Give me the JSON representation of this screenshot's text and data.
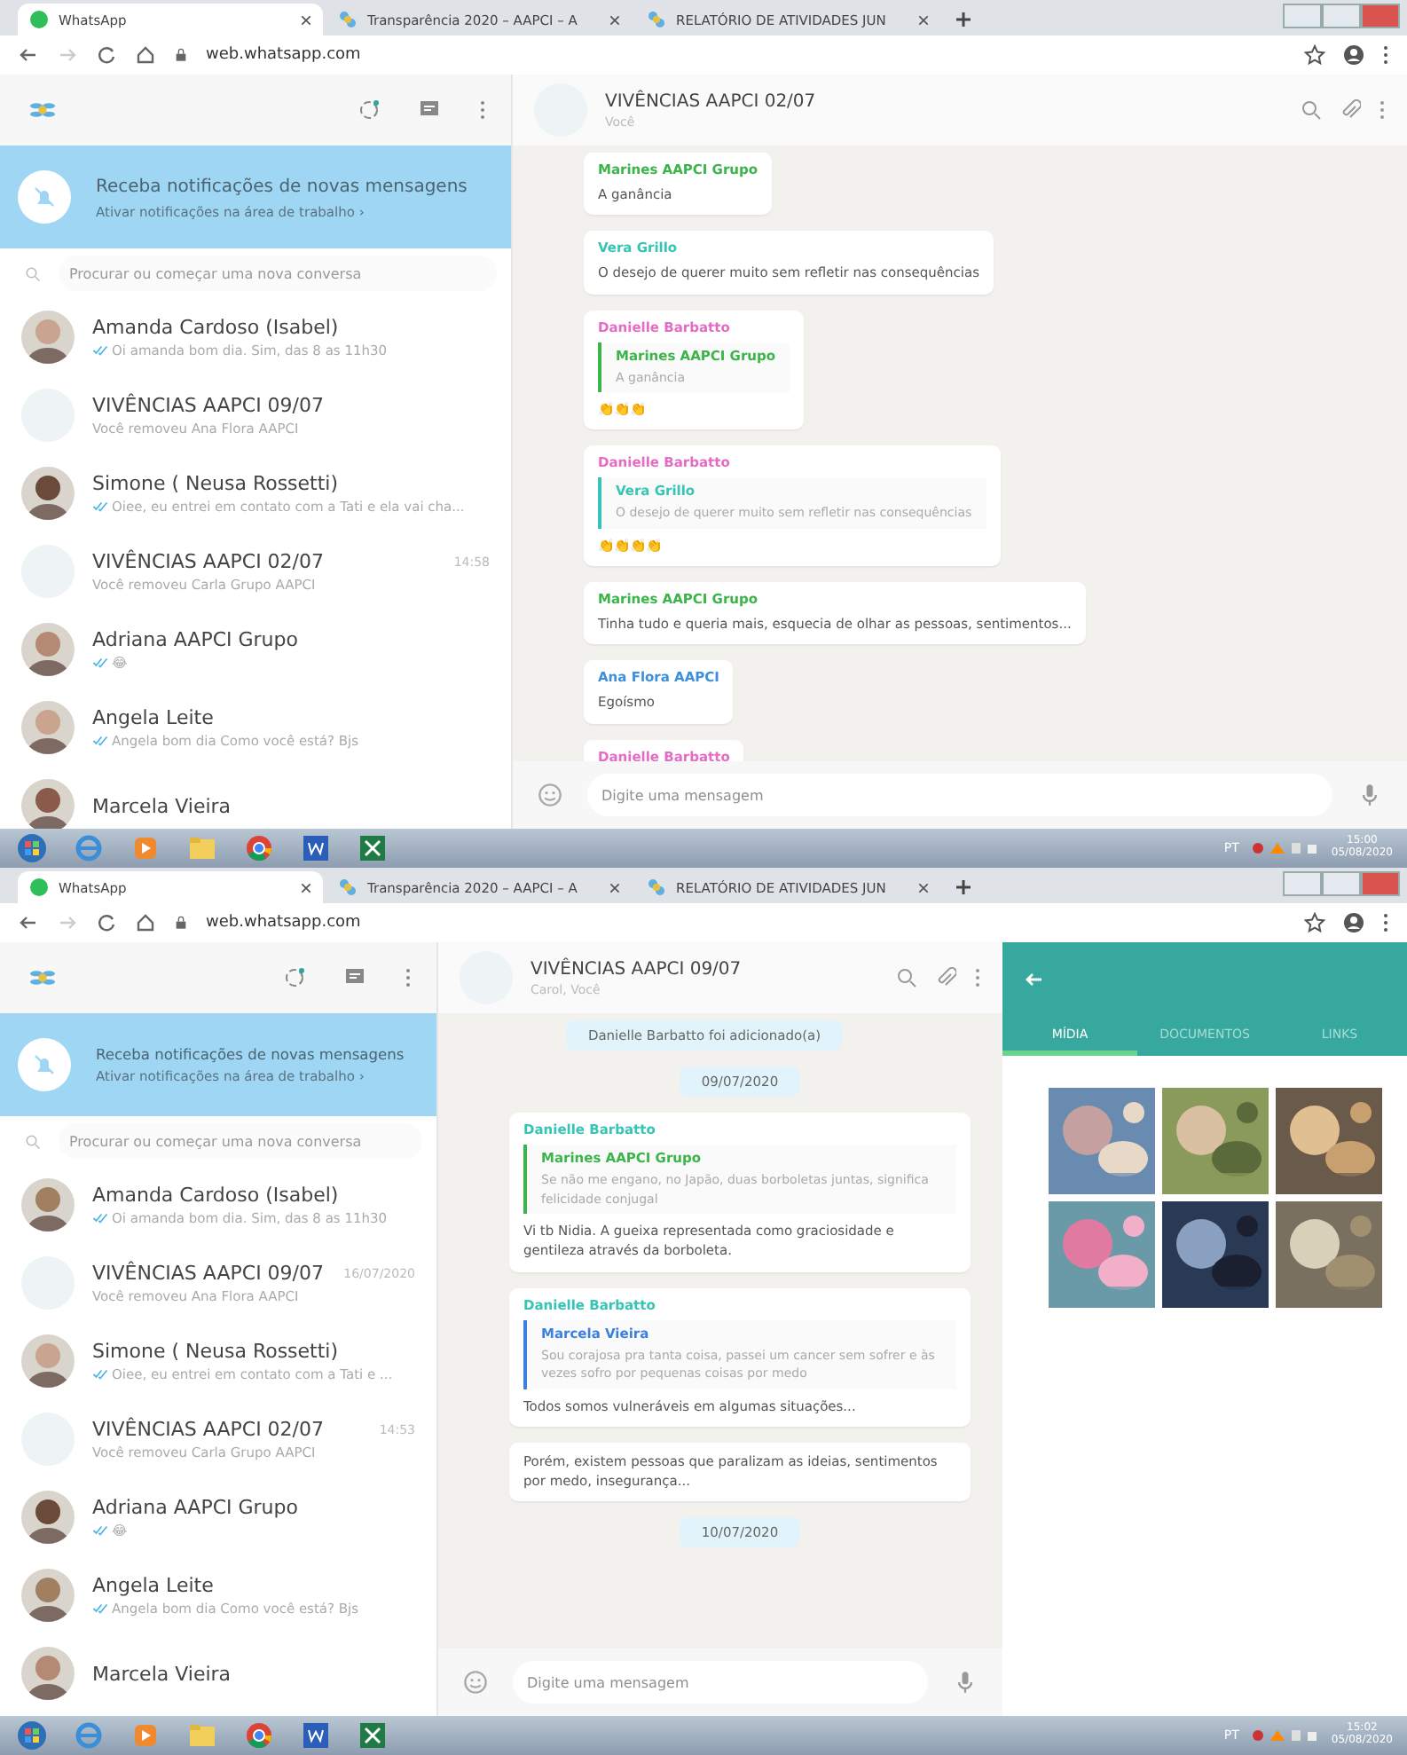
{
  "screens": [
    {
      "browser": {
        "tabs": [
          {
            "title": "WhatsApp",
            "selected": true
          },
          {
            "title": "Transparência 2020 – AAPCI – A",
            "selected": false
          },
          {
            "title": "RELATÓRIO DE ATIVIDADES JUN",
            "selected": false
          }
        ],
        "url": "web.whatsapp.com"
      },
      "sidebar": {
        "notification": {
          "title": "Receba notificações de novas mensagens",
          "link": "Ativar notificações na área de trabalho ›"
        },
        "search_placeholder": "Procurar ou começar uma nova conversa",
        "chats": [
          {
            "name": "Amanda Cardoso (Isabel)",
            "preview": "Oi amanda bom dia. Sim, das 8 as 11h30",
            "ticks": true
          },
          {
            "kind": "group",
            "name": "VIVÊNCIAS AAPCI 09/07",
            "preview": "Você removeu Ana Flora AAPCI",
            "ticks": false
          },
          {
            "name": "Simone ( Neusa Rossetti)",
            "preview": "Oiee, eu entrei em contato com a Tati e ela vai cha...",
            "ticks": true
          },
          {
            "kind": "group",
            "name": "VIVÊNCIAS AAPCI 02/07",
            "preview": "Você removeu Carla Grupo AAPCI",
            "time": "14:58",
            "ticks": false
          },
          {
            "name": "Adriana AAPCI Grupo",
            "preview": "😂",
            "ticks": true
          },
          {
            "name": "Angela Leite",
            "preview": "Angela bom dia Como você está? Bjs",
            "ticks": true
          },
          {
            "name": "Marcela Vieira"
          }
        ]
      },
      "chat": {
        "title": "VIVÊNCIAS AAPCI 02/07",
        "subtitle": "Você",
        "input_placeholder": "Digite uma mensagem",
        "messages": [
          {
            "kind": "bubble",
            "sender": "Marines AAPCI Grupo",
            "color": "#3bb54a",
            "text": "A ganância"
          },
          {
            "kind": "bubble",
            "sender": "Vera Grillo",
            "color": "#35c4b5",
            "text": "O desejo de querer muito sem refletir nas consequências"
          },
          {
            "kind": "bubble",
            "sender": "Danielle Barbatto",
            "color": "#e36cc4",
            "quote": {
              "sender": "Marines AAPCI Grupo",
              "color": "#3bb54a",
              "text": "A ganância"
            },
            "text": "👏👏👏"
          },
          {
            "kind": "bubble",
            "sender": "Danielle Barbatto",
            "color": "#e36cc4",
            "quote": {
              "sender": "Vera Grillo",
              "color": "#35c4b5",
              "text": "O desejo de querer muito sem refletir nas consequências"
            },
            "text": "👏👏👏👏"
          },
          {
            "kind": "bubble",
            "sender": "Marines AAPCI Grupo",
            "color": "#3bb54a",
            "text": "Tinha tudo e queria mais, esquecia de olhar as pessoas, sentimentos..."
          },
          {
            "kind": "bubble",
            "sender": "Ana Flora AAPCI",
            "color": "#3d8fdc",
            "text": "Egoísmo"
          },
          {
            "kind": "bubble",
            "sender": "Danielle Barbatto",
            "color": "#e36cc4"
          }
        ]
      },
      "taskbar": {
        "language": "PT",
        "time": "15:00",
        "date": "05/08/2020"
      }
    },
    {
      "browser": {
        "tabs": [
          {
            "title": "WhatsApp",
            "selected": true
          },
          {
            "title": "Transparência 2020 – AAPCI – A",
            "selected": false
          },
          {
            "title": "RELATÓRIO DE ATIVIDADES JUN",
            "selected": false
          }
        ],
        "url": "web.whatsapp.com"
      },
      "sidebar": {
        "notification": {
          "title": "Receba notificações de novas mensagens",
          "link": "Ativar notificações na área de trabalho ›"
        },
        "search_placeholder": "Procurar ou começar uma nova conversa",
        "chats": [
          {
            "name": "Amanda Cardoso (Isabel)",
            "preview": "Oi amanda bom dia. Sim, das 8 as 11h30",
            "ticks": true
          },
          {
            "kind": "group",
            "name": "VIVÊNCIAS AAPCI 09/07",
            "preview": "Você removeu Ana Flora AAPCI",
            "time": "16/07/2020",
            "ticks": false
          },
          {
            "name": "Simone ( Neusa Rossetti)",
            "preview": "Oiee, eu entrei em contato com a Tati e ...",
            "ticks": true
          },
          {
            "kind": "group",
            "name": "VIVÊNCIAS AAPCI 02/07",
            "preview": "Você removeu Carla Grupo AAPCI",
            "time": "14:53",
            "ticks": false
          },
          {
            "name": "Adriana AAPCI Grupo",
            "preview": "😂",
            "ticks": true
          },
          {
            "name": "Angela Leite",
            "preview": "Angela bom dia Como você está? Bjs",
            "ticks": true
          },
          {
            "name": "Marcela Vieira"
          }
        ]
      },
      "chat": {
        "title": "VIVÊNCIAS AAPCI 09/07",
        "subtitle": "Carol, Você",
        "input_placeholder": "Digite uma mensagem",
        "messages": [
          {
            "kind": "system",
            "text": "Danielle Barbatto foi adicionado(a)"
          },
          {
            "kind": "date",
            "text": "09/07/2020"
          },
          {
            "kind": "bubble",
            "sender": "Danielle Barbatto",
            "color": "#35c4b5",
            "quote": {
              "sender": "Marines AAPCI Grupo",
              "color": "#3bb54a",
              "text": "Se não me engano, no Japão, duas borboletas juntas, significa felicidade conjugal"
            },
            "text": "Vi tb Nidia. A gueixa representada como graciosidade e gentileza através da borboleta."
          },
          {
            "kind": "bubble",
            "sender": "Danielle Barbatto",
            "color": "#35c4b5",
            "quote": {
              "sender": "Marcela Vieira",
              "color": "#3d7fdc",
              "text": "Sou corajosa pra tanta coisa, passei um cancer sem sofrer e às vezes sofro por pequenas coisas por medo"
            },
            "text": "Todos somos vulneráveis em algumas situações..."
          },
          {
            "kind": "bubble",
            "text": "Porém, existem pessoas que paralizam as ideias, sentimentos por medo, insegurança..."
          },
          {
            "kind": "date",
            "text": "10/07/2020"
          }
        ]
      },
      "media_panel": {
        "tabs": [
          {
            "label": "MÍDIA",
            "selected": true
          },
          {
            "label": "DOCUMENTOS",
            "selected": false
          },
          {
            "label": "LINKS",
            "selected": false
          }
        ]
      },
      "taskbar": {
        "language": "PT",
        "time": "15:02",
        "date": "05/08/2020"
      }
    }
  ]
}
